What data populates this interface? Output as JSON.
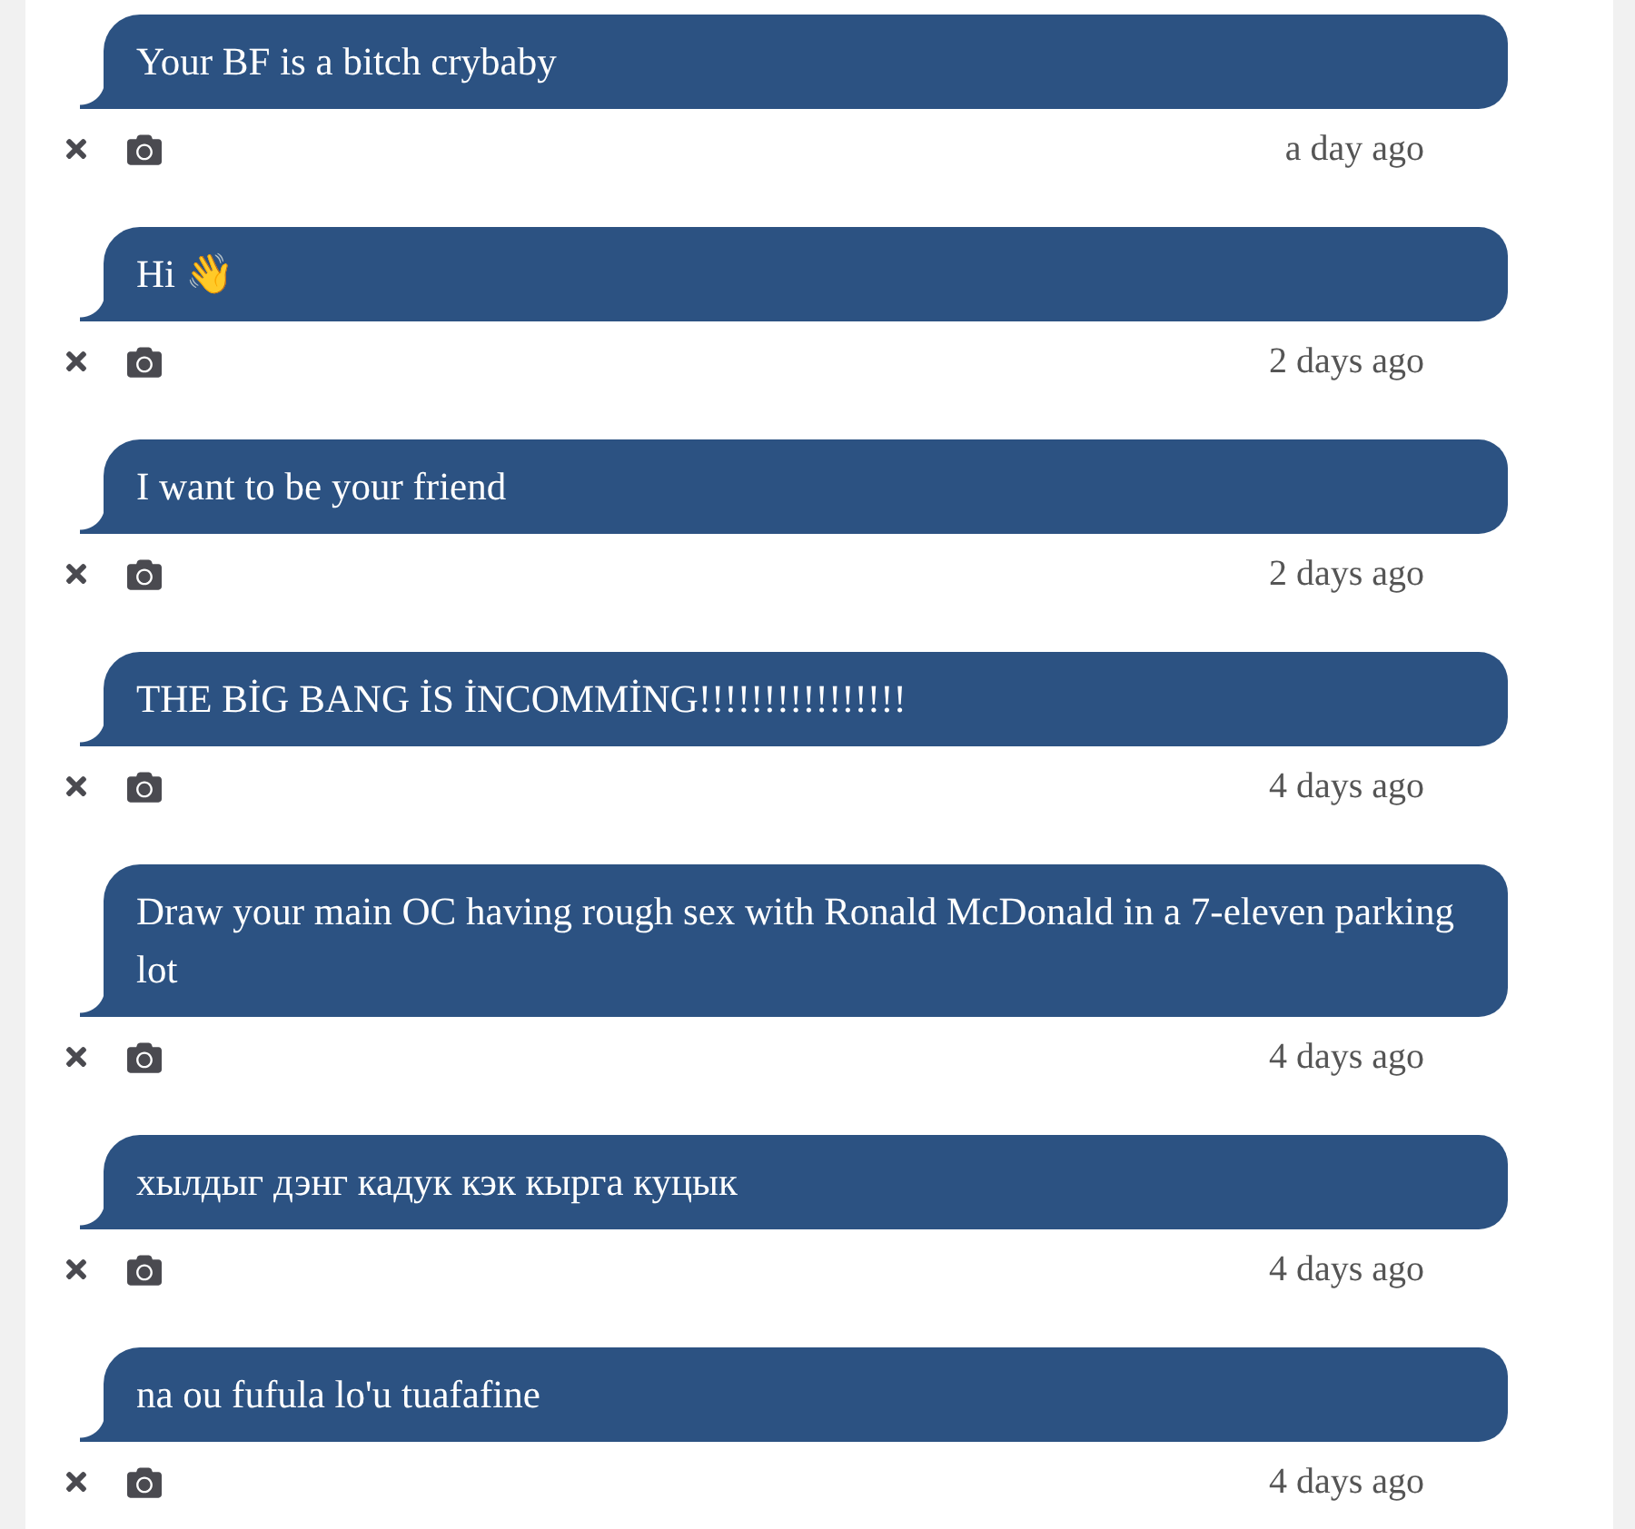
{
  "messages": [
    {
      "text": "Your BF is a bitch crybaby",
      "time": "a day ago"
    },
    {
      "text": "Hi 👋",
      "time": "2 days ago"
    },
    {
      "text": "I want to be your friend",
      "time": "2 days ago"
    },
    {
      "text": "THE BİG BANG İS İNCOMMİNG!!!!!!!!!!!!!!!!",
      "time": "4 days ago"
    },
    {
      "text": "Draw your main OC having rough sex with Ronald McDonald in a 7-eleven parking lot",
      "time": "4 days ago"
    },
    {
      "text": "хылдыг дэнг кадук кэк кырга куцык",
      "time": "4 days ago"
    },
    {
      "text": "na ou fufula lo'u tuafafine",
      "time": "4 days ago"
    }
  ]
}
